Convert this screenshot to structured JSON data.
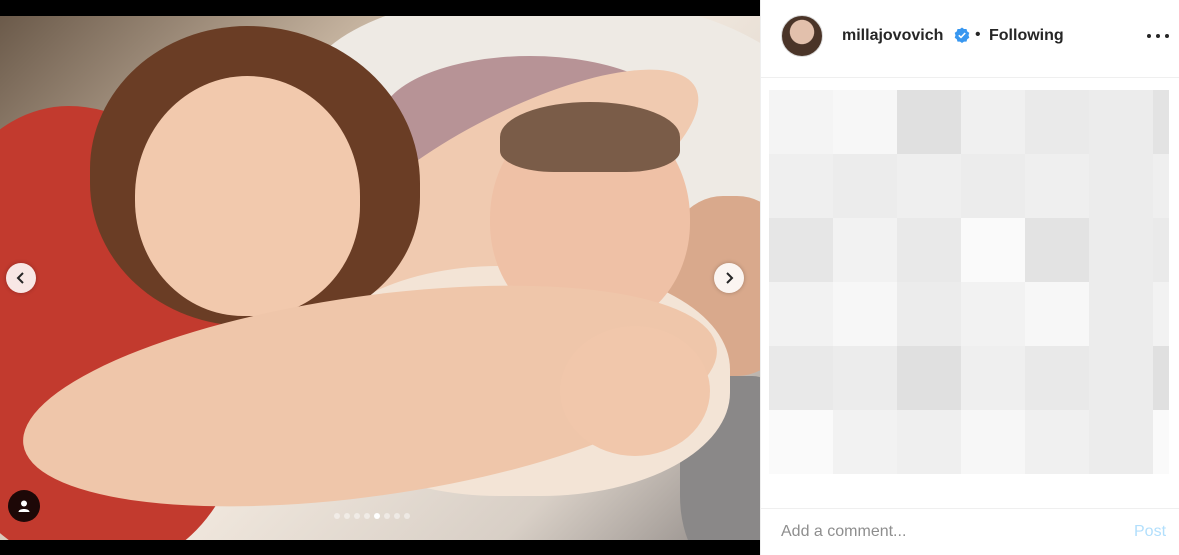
{
  "post": {
    "username": "millajovovich",
    "verified": true,
    "separator": "•",
    "follow_status": "Following",
    "more_icon": "more-horizontal-icon",
    "avatar_icon": "profile-avatar"
  },
  "media": {
    "carousel_count": 8,
    "carousel_active_index": 4,
    "prev_icon": "chevron-left-icon",
    "next_icon": "chevron-right-icon",
    "tag_icon": "user-tag-icon"
  },
  "comment_box": {
    "placeholder": "Add a comment...",
    "post_label": "Post"
  },
  "colors": {
    "post_button_disabled": "#b2dffc",
    "verified_badge": "#3897f0",
    "text": "#262626",
    "muted": "#8e8e8e"
  }
}
